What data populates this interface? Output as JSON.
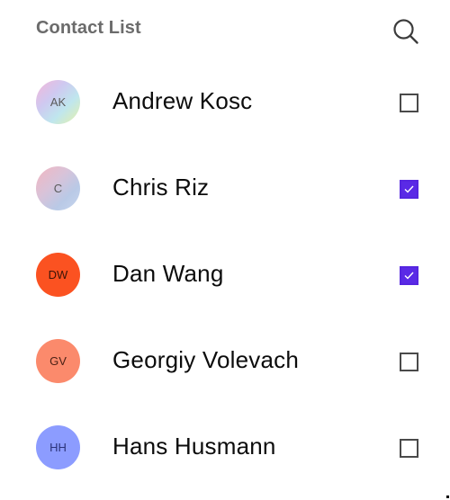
{
  "header": {
    "title": "Contact List",
    "search_icon": "search-icon"
  },
  "colors": {
    "checked": "#5a2ae6",
    "title": "#6b6b6b"
  },
  "contacts": [
    {
      "initials": "AK",
      "name": "Andrew Kosc",
      "checked": false,
      "avatar_background": "linear-gradient(135deg, #f4b8d8 0%, #cfc8f0 35%, #bfe6ee 65%, #e7f0a8 100%)",
      "initials_color": "#5a5a5a"
    },
    {
      "initials": "C",
      "name": "Chris Riz",
      "checked": true,
      "avatar_background": "linear-gradient(135deg, #f3b6c0 0%, #d8c3d9 40%, #b9c9e6 70%, #c7d6ee 100%)",
      "initials_color": "#5a5a5a"
    },
    {
      "initials": "DW",
      "name": "Dan Wang",
      "checked": true,
      "avatar_background": "#fb5221",
      "initials_color": "#3a1407"
    },
    {
      "initials": "GV",
      "name": "Georgiy Volevach",
      "checked": false,
      "avatar_background": "#fb8a6c",
      "initials_color": "#4b2116"
    },
    {
      "initials": "HH",
      "name": "Hans Husmann",
      "checked": false,
      "avatar_background": "#8c9cff",
      "initials_color": "#2b337a"
    }
  ]
}
